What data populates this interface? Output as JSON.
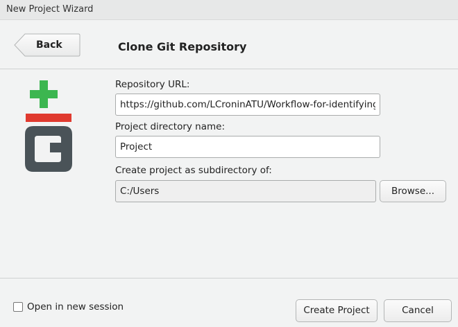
{
  "window": {
    "title": "New Project Wizard"
  },
  "header": {
    "back_label": "Back",
    "page_title": "Clone Git Repository"
  },
  "form": {
    "repo_url_label": "Repository URL:",
    "repo_url_value": "https://github.com/LCroninATU/Workflow-for-identifying",
    "dir_name_label": "Project directory name:",
    "dir_name_value": "Project",
    "subdir_label": "Create project as subdirectory of:",
    "subdir_value": "C:/Users",
    "browse_label": "Browse..."
  },
  "footer": {
    "open_new_session_label": "Open in new session",
    "open_new_session_checked": false,
    "create_label": "Create Project",
    "cancel_label": "Cancel"
  },
  "logo": {
    "icon": "git-logo-icon",
    "colors": {
      "plus": "#3cb650",
      "bar": "#e03a2f",
      "g": "#4a5358"
    }
  }
}
